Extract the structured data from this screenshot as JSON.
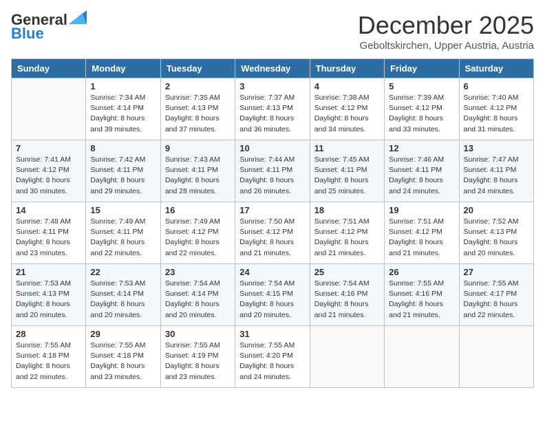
{
  "header": {
    "logo_general": "General",
    "logo_blue": "Blue",
    "month_title": "December 2025",
    "location": "Geboltskirchen, Upper Austria, Austria"
  },
  "days_of_week": [
    "Sunday",
    "Monday",
    "Tuesday",
    "Wednesday",
    "Thursday",
    "Friday",
    "Saturday"
  ],
  "weeks": [
    [
      {
        "day": "",
        "sunrise": "",
        "sunset": "",
        "daylight": ""
      },
      {
        "day": "1",
        "sunrise": "Sunrise: 7:34 AM",
        "sunset": "Sunset: 4:14 PM",
        "daylight": "Daylight: 8 hours and 39 minutes."
      },
      {
        "day": "2",
        "sunrise": "Sunrise: 7:35 AM",
        "sunset": "Sunset: 4:13 PM",
        "daylight": "Daylight: 8 hours and 37 minutes."
      },
      {
        "day": "3",
        "sunrise": "Sunrise: 7:37 AM",
        "sunset": "Sunset: 4:13 PM",
        "daylight": "Daylight: 8 hours and 36 minutes."
      },
      {
        "day": "4",
        "sunrise": "Sunrise: 7:38 AM",
        "sunset": "Sunset: 4:12 PM",
        "daylight": "Daylight: 8 hours and 34 minutes."
      },
      {
        "day": "5",
        "sunrise": "Sunrise: 7:39 AM",
        "sunset": "Sunset: 4:12 PM",
        "daylight": "Daylight: 8 hours and 33 minutes."
      },
      {
        "day": "6",
        "sunrise": "Sunrise: 7:40 AM",
        "sunset": "Sunset: 4:12 PM",
        "daylight": "Daylight: 8 hours and 31 minutes."
      }
    ],
    [
      {
        "day": "7",
        "sunrise": "Sunrise: 7:41 AM",
        "sunset": "Sunset: 4:12 PM",
        "daylight": "Daylight: 8 hours and 30 minutes."
      },
      {
        "day": "8",
        "sunrise": "Sunrise: 7:42 AM",
        "sunset": "Sunset: 4:11 PM",
        "daylight": "Daylight: 8 hours and 29 minutes."
      },
      {
        "day": "9",
        "sunrise": "Sunrise: 7:43 AM",
        "sunset": "Sunset: 4:11 PM",
        "daylight": "Daylight: 8 hours and 28 minutes."
      },
      {
        "day": "10",
        "sunrise": "Sunrise: 7:44 AM",
        "sunset": "Sunset: 4:11 PM",
        "daylight": "Daylight: 8 hours and 26 minutes."
      },
      {
        "day": "11",
        "sunrise": "Sunrise: 7:45 AM",
        "sunset": "Sunset: 4:11 PM",
        "daylight": "Daylight: 8 hours and 25 minutes."
      },
      {
        "day": "12",
        "sunrise": "Sunrise: 7:46 AM",
        "sunset": "Sunset: 4:11 PM",
        "daylight": "Daylight: 8 hours and 24 minutes."
      },
      {
        "day": "13",
        "sunrise": "Sunrise: 7:47 AM",
        "sunset": "Sunset: 4:11 PM",
        "daylight": "Daylight: 8 hours and 24 minutes."
      }
    ],
    [
      {
        "day": "14",
        "sunrise": "Sunrise: 7:48 AM",
        "sunset": "Sunset: 4:11 PM",
        "daylight": "Daylight: 8 hours and 23 minutes."
      },
      {
        "day": "15",
        "sunrise": "Sunrise: 7:49 AM",
        "sunset": "Sunset: 4:11 PM",
        "daylight": "Daylight: 8 hours and 22 minutes."
      },
      {
        "day": "16",
        "sunrise": "Sunrise: 7:49 AM",
        "sunset": "Sunset: 4:12 PM",
        "daylight": "Daylight: 8 hours and 22 minutes."
      },
      {
        "day": "17",
        "sunrise": "Sunrise: 7:50 AM",
        "sunset": "Sunset: 4:12 PM",
        "daylight": "Daylight: 8 hours and 21 minutes."
      },
      {
        "day": "18",
        "sunrise": "Sunrise: 7:51 AM",
        "sunset": "Sunset: 4:12 PM",
        "daylight": "Daylight: 8 hours and 21 minutes."
      },
      {
        "day": "19",
        "sunrise": "Sunrise: 7:51 AM",
        "sunset": "Sunset: 4:12 PM",
        "daylight": "Daylight: 8 hours and 21 minutes."
      },
      {
        "day": "20",
        "sunrise": "Sunrise: 7:52 AM",
        "sunset": "Sunset: 4:13 PM",
        "daylight": "Daylight: 8 hours and 20 minutes."
      }
    ],
    [
      {
        "day": "21",
        "sunrise": "Sunrise: 7:53 AM",
        "sunset": "Sunset: 4:13 PM",
        "daylight": "Daylight: 8 hours and 20 minutes."
      },
      {
        "day": "22",
        "sunrise": "Sunrise: 7:53 AM",
        "sunset": "Sunset: 4:14 PM",
        "daylight": "Daylight: 8 hours and 20 minutes."
      },
      {
        "day": "23",
        "sunrise": "Sunrise: 7:54 AM",
        "sunset": "Sunset: 4:14 PM",
        "daylight": "Daylight: 8 hours and 20 minutes."
      },
      {
        "day": "24",
        "sunrise": "Sunrise: 7:54 AM",
        "sunset": "Sunset: 4:15 PM",
        "daylight": "Daylight: 8 hours and 20 minutes."
      },
      {
        "day": "25",
        "sunrise": "Sunrise: 7:54 AM",
        "sunset": "Sunset: 4:16 PM",
        "daylight": "Daylight: 8 hours and 21 minutes."
      },
      {
        "day": "26",
        "sunrise": "Sunrise: 7:55 AM",
        "sunset": "Sunset: 4:16 PM",
        "daylight": "Daylight: 8 hours and 21 minutes."
      },
      {
        "day": "27",
        "sunrise": "Sunrise: 7:55 AM",
        "sunset": "Sunset: 4:17 PM",
        "daylight": "Daylight: 8 hours and 22 minutes."
      }
    ],
    [
      {
        "day": "28",
        "sunrise": "Sunrise: 7:55 AM",
        "sunset": "Sunset: 4:18 PM",
        "daylight": "Daylight: 8 hours and 22 minutes."
      },
      {
        "day": "29",
        "sunrise": "Sunrise: 7:55 AM",
        "sunset": "Sunset: 4:18 PM",
        "daylight": "Daylight: 8 hours and 23 minutes."
      },
      {
        "day": "30",
        "sunrise": "Sunrise: 7:55 AM",
        "sunset": "Sunset: 4:19 PM",
        "daylight": "Daylight: 8 hours and 23 minutes."
      },
      {
        "day": "31",
        "sunrise": "Sunrise: 7:55 AM",
        "sunset": "Sunset: 4:20 PM",
        "daylight": "Daylight: 8 hours and 24 minutes."
      },
      {
        "day": "",
        "sunrise": "",
        "sunset": "",
        "daylight": ""
      },
      {
        "day": "",
        "sunrise": "",
        "sunset": "",
        "daylight": ""
      },
      {
        "day": "",
        "sunrise": "",
        "sunset": "",
        "daylight": ""
      }
    ]
  ]
}
